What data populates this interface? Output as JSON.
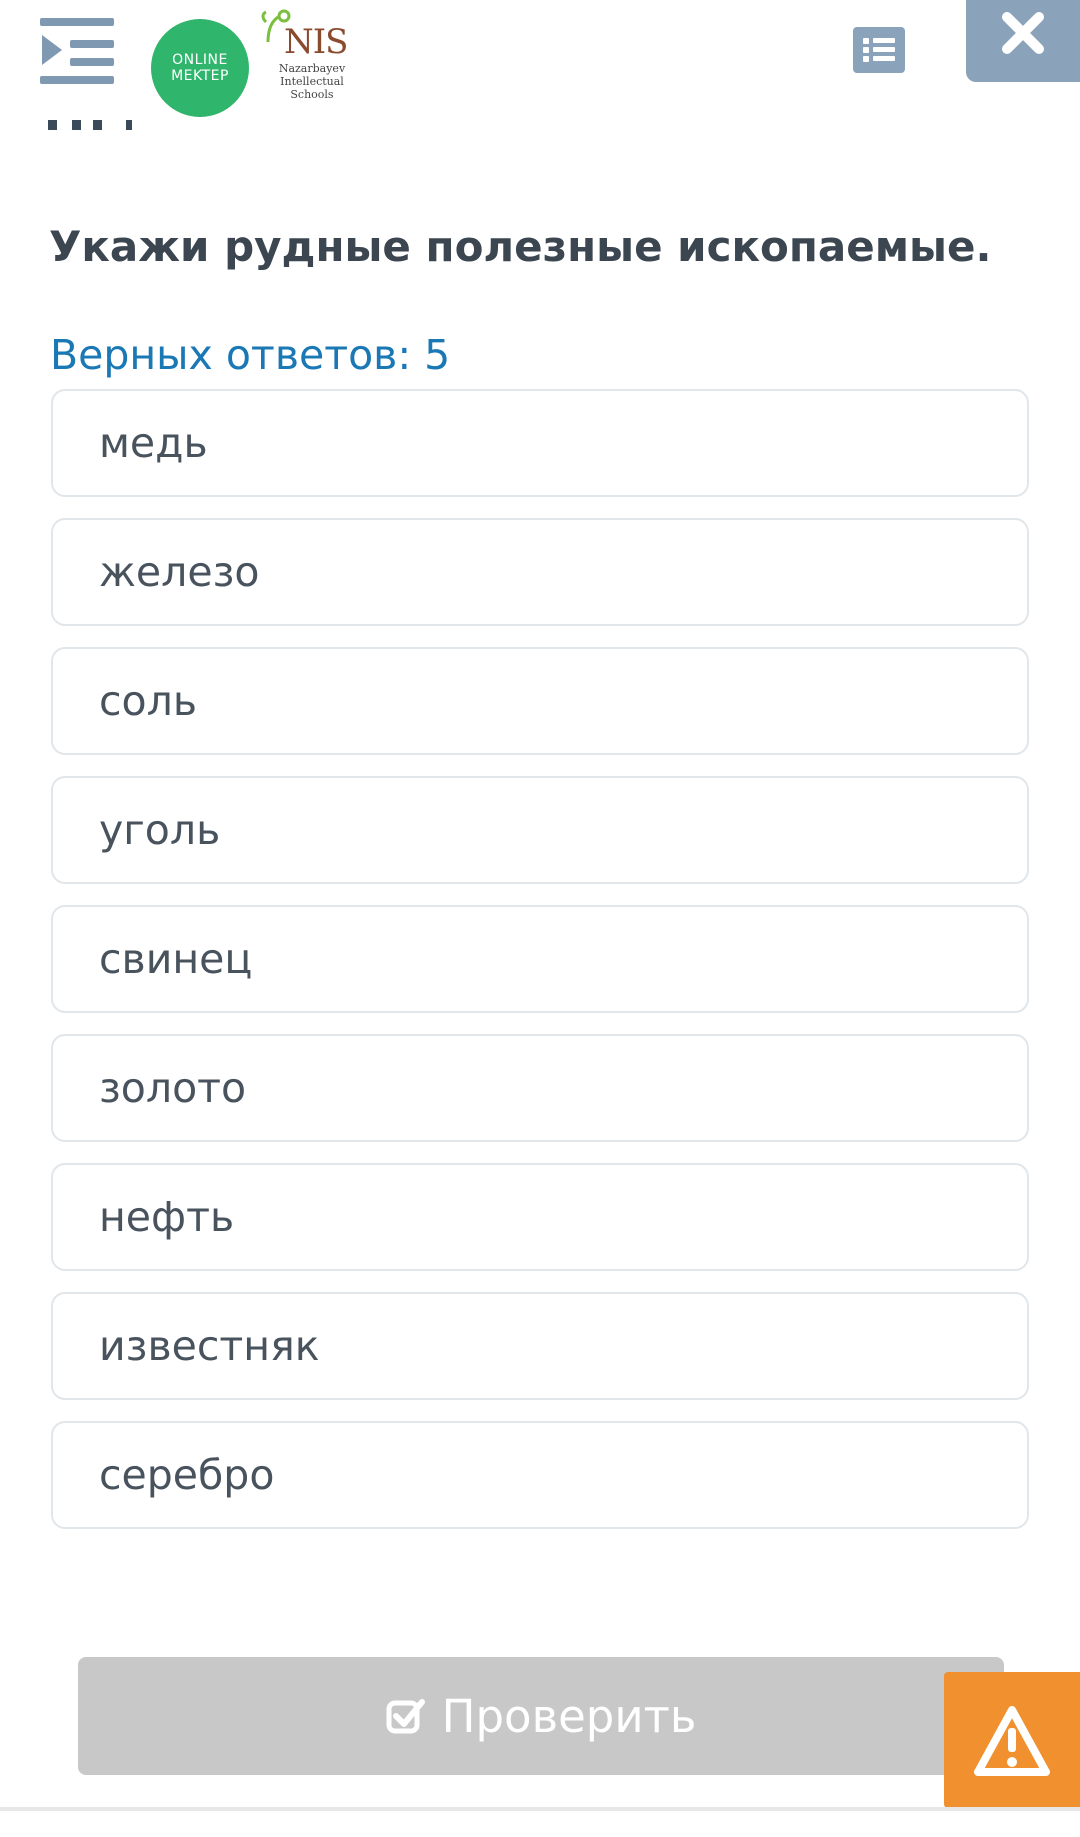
{
  "header": {
    "logo_online": [
      "ONLINE",
      "MEKTEP"
    ],
    "nis_short": "NIS",
    "nis_full": [
      "Nazarbayev",
      "Intellectual",
      "Schools"
    ]
  },
  "question": {
    "title": "Укажи рудные полезные ископаемые.",
    "answers_count": "Верных ответов: 5",
    "options": [
      "медь",
      "железо",
      "соль",
      "уголь",
      "свинец",
      "золото",
      "нефть",
      "известняк",
      "серебро"
    ]
  },
  "actions": {
    "check_label": "Проверить"
  },
  "colors": {
    "accent_blue": "#1a78b5",
    "menu_icon": "#7f99b2",
    "online_green": "#2fb56c",
    "warning_orange": "#f1902e",
    "disabled_gray": "#c8c8c8"
  },
  "icons": [
    "menu-icon",
    "list-icon",
    "close-icon",
    "checkbox-icon",
    "warning-icon"
  ]
}
